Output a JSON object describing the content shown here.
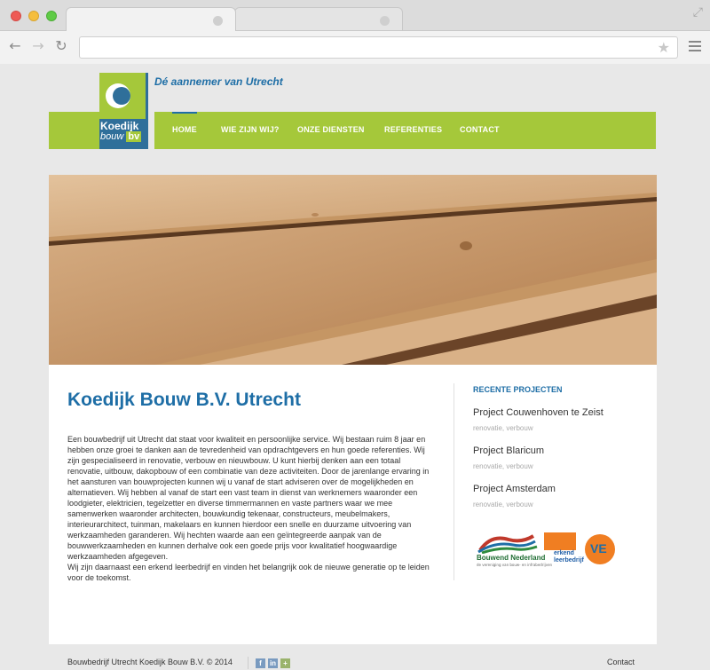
{
  "site": {
    "logo_line1": "Koedijk",
    "logo_line2": "bouw",
    "logo_suffix": "bv",
    "tagline": "Dé aannemer van Utrecht"
  },
  "nav": {
    "items": [
      {
        "label": "HOME",
        "active": true
      },
      {
        "label": "WIE ZIJN WIJ?"
      },
      {
        "label": "ONZE DIENSTEN"
      },
      {
        "label": "REFERENTIES"
      },
      {
        "label": "CONTACT"
      }
    ]
  },
  "main": {
    "title": "Koedijk Bouw B.V. Utrecht",
    "paragraph1": "Een bouwbedrijf uit Utrecht dat staat voor kwaliteit en persoonlijke service. Wij bestaan ruim 8 jaar en hebben onze groei te danken aan de tevredenheid van opdrachtgevers en hun goede referenties. Wij zijn gespecialiseerd in renovatie, verbouw en nieuwbouw. U kunt hierbij denken aan een totaal renovatie, uitbouw, dakopbouw of een combinatie van deze activiteiten. Door de jarenlange ervaring in het aansturen van bouwprojecten kunnen wij u vanaf de start adviseren over de mogelijkheden en alternatieven. Wij hebben al vanaf de start een vast team in dienst van werknemers waaronder een loodgieter, elektricien, tegelzetter en diverse timmermannen en vaste partners waar we mee samenwerken waaronder architecten, bouwkundig tekenaar, constructeurs, meubelmakers, interieurarchitect, tuinman, makelaars en kunnen hierdoor een snelle en duurzame uitvoering van werkzaamheden garanderen. Wij hechten waarde aan een geïntegreerde aanpak van de bouwwerkzaamheden en kunnen derhalve ook een goede prijs voor kwalitatief hoogwaardige werkzaamheden afgegeven.",
    "paragraph2": "Wij zijn daarnaast een erkend leerbedrijf en vinden het belangrijk ook de nieuwe generatie op te leiden voor de toekomst."
  },
  "sidebar": {
    "title": "RECENTE PROJECTEN",
    "projects": [
      {
        "name": "Project Couwenhoven te Zeist",
        "tags": "renovatie, verbouw"
      },
      {
        "name": "Project Blaricum",
        "tags": "renovatie, verbouw"
      },
      {
        "name": "Project Amsterdam",
        "tags": "renovatie, verbouw"
      }
    ],
    "badges": {
      "bn_title": "Bouwend Nederland",
      "bn_sub": "de vereniging van bouw- en infrabedrijven",
      "erk_line1": "erkend",
      "erk_line2": "leerbedrijf",
      "ve": "VE"
    }
  },
  "footer": {
    "copyright": "Bouwbedrijf Utrecht Koedijk Bouw B.V. © 2014",
    "contact": "Contact",
    "social": [
      "f",
      "in",
      "+"
    ]
  },
  "colors": {
    "green": "#a5c83a",
    "blue": "#1e6ea6"
  }
}
